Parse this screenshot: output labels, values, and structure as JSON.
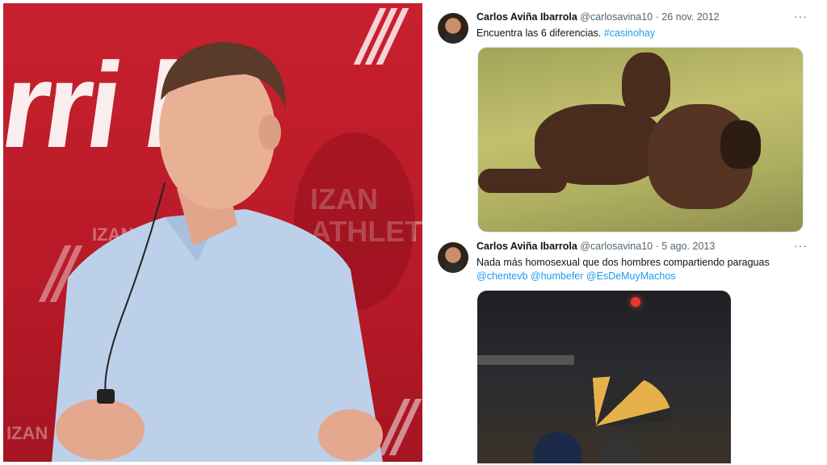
{
  "photo": {
    "bg_big_text": "rri bt",
    "bg_small_1": "IZAN",
    "bg_small_2": "ATHLETIC",
    "bg_small_3": "IZAN",
    "bg_small_4": "IZAN"
  },
  "tweets": [
    {
      "name": "Carlos Aviña Ibarrola",
      "handle": "@carlosavina10",
      "dot": "·",
      "date": "26 nov. 2012",
      "more": "···",
      "text": "Encuentra las 6 diferencias.",
      "hashtag": "#casinohay"
    },
    {
      "name": "Carlos Aviña Ibarrola",
      "handle": "@carlosavina10",
      "dot": "·",
      "date": "5 ago. 2013",
      "more": "···",
      "text": "Nada más homosexual que dos hombres compartiendo paraguas",
      "mentions": [
        "@chentevb",
        "@humbefer",
        "@EsDeMuyMachos"
      ]
    }
  ],
  "colors": {
    "photo_bg": "#c8202e",
    "link": "#1d9bf0",
    "text": "#0f1419",
    "meta": "#536471"
  }
}
